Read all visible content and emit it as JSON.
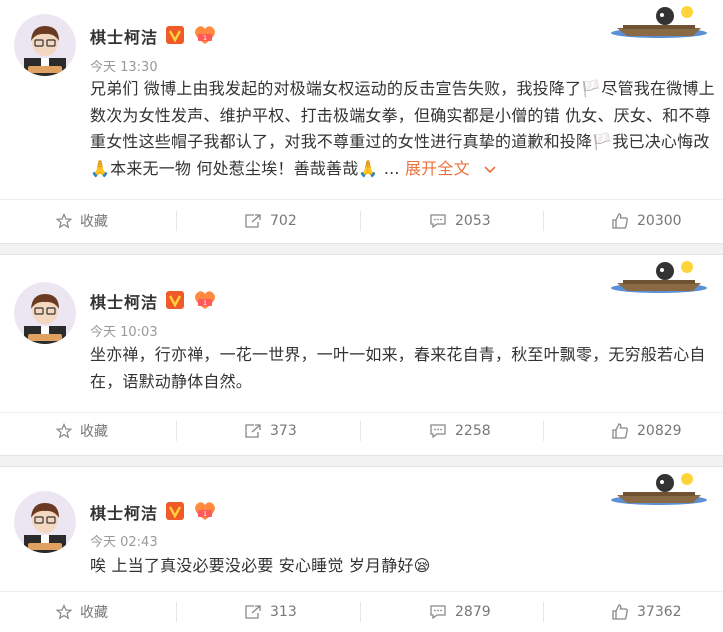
{
  "posts": [
    {
      "username": "棋士柯洁",
      "time": "今天 13:30",
      "content": "兄弟们 微博上由我发起的对极端女权运动的反击宣告失败，我投降了🏳️尽管我在微博上数次为女性发声、维护平权、打击极端女拳，但确实都是小僧的错 仇女、厌女、和不尊重女性这些帽子我都认了，对我不尊重过的女性进行真挚的道歉和投降🏳️我已决心悔改🙏本来无一物 何处惹尘埃！善哉善哉🙏 ...",
      "expand_label": "展开全文",
      "actions": {
        "favorite": "收藏",
        "repost": "702",
        "comment": "2053",
        "like": "20300"
      }
    },
    {
      "username": "棋士柯洁",
      "time": "今天 10:03",
      "content": "坐亦禅，行亦禅，一花一世界，一叶一如来，春来花自青，秋至叶飘零，无穷般若心自在，语默动静体自然。",
      "actions": {
        "favorite": "收藏",
        "repost": "373",
        "comment": "2258",
        "like": "20829"
      }
    },
    {
      "username": "棋士柯洁",
      "time": "今天 02:43",
      "content": "唉 上当了真没必要没必要  安心睡觉 岁月静好😪",
      "actions": {
        "favorite": "收藏",
        "repost": "313",
        "comment": "2879",
        "like": "37362"
      }
    }
  ],
  "colors": {
    "accent": "#eb7340",
    "vip": "#f05a28",
    "muted": "#999999"
  },
  "icons": [
    "star-icon",
    "repost-icon",
    "comment-icon",
    "thumbs-up-icon",
    "chevron-down-icon",
    "vip-badge-icon",
    "fan-badge-icon",
    "boat-decoration-icon"
  ]
}
